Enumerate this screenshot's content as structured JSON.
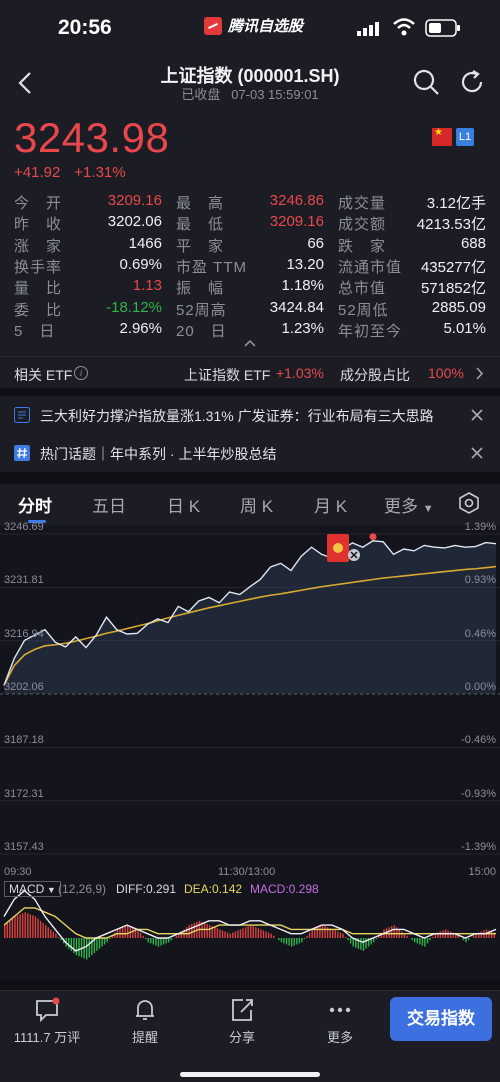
{
  "status_bar": {
    "time": "20:56",
    "app_name": "腾讯自选股"
  },
  "header": {
    "title": "上证指数 (000001.SH)",
    "market_status": "已收盘",
    "timestamp": "07-03 15:59:01"
  },
  "quote": {
    "last_price": "3243.98",
    "change": "+41.92",
    "change_pct": "+1.31%",
    "badge": "L1",
    "stats": [
      [
        {
          "label": "今　开",
          "value": "3209.16",
          "color": "red"
        },
        {
          "label": "最　高",
          "value": "3246.86",
          "color": "red"
        },
        {
          "label": "成交量",
          "value": "3.12亿手",
          "color": "white"
        }
      ],
      [
        {
          "label": "昨　收",
          "value": "3202.06",
          "color": "white"
        },
        {
          "label": "最　低",
          "value": "3209.16",
          "color": "red"
        },
        {
          "label": "成交额",
          "value": "4213.53亿",
          "color": "white"
        }
      ],
      [
        {
          "label": "涨　家",
          "value": "1466",
          "color": "white"
        },
        {
          "label": "平　家",
          "value": "66",
          "color": "white"
        },
        {
          "label": "跌　家",
          "value": "688",
          "color": "white"
        }
      ],
      [
        {
          "label": "换手率",
          "value": "0.69%",
          "color": "white"
        },
        {
          "label": "市盈 TTM",
          "value": "13.20",
          "color": "white"
        },
        {
          "label": "流通市值",
          "value": "435277亿",
          "color": "white"
        }
      ],
      [
        {
          "label": "量　比",
          "value": "1.13",
          "color": "red"
        },
        {
          "label": "振　幅",
          "value": "1.18%",
          "color": "white"
        },
        {
          "label": "总市值",
          "value": "571852亿",
          "color": "white"
        }
      ],
      [
        {
          "label": "委　比",
          "value": "-18.12%",
          "color": "green"
        },
        {
          "label": "52周高",
          "value": "3424.84",
          "color": "white"
        },
        {
          "label": "52周低",
          "value": "2885.09",
          "color": "white"
        }
      ],
      [
        {
          "label": "5　日",
          "value": "2.96%",
          "color": "white"
        },
        {
          "label": "20　日",
          "value": "1.23%",
          "color": "white"
        },
        {
          "label": "年初至今",
          "value": "5.01%",
          "color": "white"
        }
      ]
    ]
  },
  "etf": {
    "label": "相关 ETF",
    "name": "上证指数 ETF",
    "change": "+1.03%",
    "constituent_label": "成分股占比",
    "constituent_value": "100%"
  },
  "news": [
    {
      "text": "三大利好力撑沪指放量涨1.31% 广发证券：行业布局有三大思路"
    },
    {
      "text": "热门话题｜年中系列 · 上半年炒股总结"
    }
  ],
  "tabs": [
    "分时",
    "五日",
    "日 K",
    "周 K",
    "月 K",
    "更多"
  ],
  "active_tab": "分时",
  "chart_data": [
    {
      "type": "line",
      "title": "",
      "x_range": [
        "09:30",
        "15:00"
      ],
      "x_ticks": [
        "09:30",
        "11:30/13:00",
        "15:00"
      ],
      "y_ticks_left": [
        "3246.69",
        "3231.81",
        "3216.94",
        "3202.06",
        "3187.18",
        "3172.31",
        "3157.43"
      ],
      "y_ticks_right": [
        "1.39%",
        "0.93%",
        "0.46%",
        "0.00%",
        "-0.46%",
        "-0.93%",
        "-1.39%"
      ],
      "ylim": [
        3157.43,
        3246.69
      ],
      "baseline": 3202.06,
      "series": [
        {
          "values": [
            3204.5,
            3212.0,
            3217.0,
            3218.5,
            3220.0,
            3216.5,
            3215.2,
            3218.0,
            3215.0,
            3218.5,
            3223.5,
            3220.0,
            3218.8,
            3219.0,
            3221.5,
            3223.0,
            3222.0,
            3226.5,
            3225.0,
            3228.0,
            3229.0,
            3227.5,
            3230.5,
            3229.8,
            3232.0,
            3234.0,
            3237.5,
            3238.5,
            3236.5,
            3240.5,
            3243.0,
            3241.0,
            3240.0,
            3242.5,
            3244.2,
            3243.0,
            3244.8,
            3244.5,
            3241.0,
            3242.5,
            3242.0,
            3243.5,
            3243.0,
            3242.8,
            3243.5,
            3243.0,
            3243.2,
            3244.3,
            3244.0
          ]
        },
        {
          "values": [
            3204.5,
            3210.0,
            3213.0,
            3214.5,
            3215.5,
            3215.8,
            3216.2,
            3216.8,
            3217.5,
            3218.2,
            3219.0,
            3219.6,
            3220.3,
            3221.0,
            3221.7,
            3222.5,
            3223.3,
            3224.0,
            3224.7,
            3225.4,
            3226.1,
            3226.7,
            3227.3,
            3227.9,
            3228.5,
            3229.1,
            3229.6,
            3230.0,
            3230.5,
            3231.0,
            3231.5,
            3232.0,
            3232.4,
            3232.8,
            3233.2,
            3233.6,
            3234.0,
            3234.4,
            3234.7,
            3235.0,
            3235.3,
            3235.6,
            3235.9,
            3236.2,
            3236.5,
            3236.8,
            3237.0,
            3237.3,
            3237.6
          ]
        }
      ]
    },
    {
      "type": "bar",
      "title": "MACD",
      "params": "(12,26,9)",
      "diff": "0.291",
      "dea": "0.142",
      "macd": "0.298",
      "series": [
        {
          "name": "MACD",
          "values": [
            3,
            5,
            6,
            5,
            3,
            1,
            -2,
            -4,
            -5,
            -3,
            -1,
            2,
            3,
            2,
            -1,
            -2,
            -1,
            1,
            3,
            4,
            3,
            2,
            1,
            2,
            3,
            2,
            1,
            -1,
            -2,
            -1,
            2,
            3,
            2,
            1,
            -2,
            -3,
            -1,
            2,
            3,
            1,
            -1,
            -2,
            1,
            2,
            1,
            -1,
            1,
            2,
            1
          ]
        },
        {
          "name": "DIFF",
          "values": [
            5,
            9,
            11,
            9,
            5,
            2,
            -1,
            -3,
            -2,
            0,
            1,
            2,
            3,
            2,
            1,
            0,
            0,
            1,
            2,
            3,
            4,
            4,
            3,
            3,
            4,
            4,
            3,
            2,
            1,
            1,
            2,
            3,
            3,
            2,
            0,
            -1,
            0,
            1,
            2,
            2,
            1,
            0,
            1,
            1,
            1,
            0,
            1,
            1,
            2
          ]
        },
        {
          "name": "DEA",
          "values": [
            3,
            5,
            7,
            7,
            6,
            5,
            3,
            1,
            0,
            0,
            0,
            1,
            1,
            2,
            2,
            1,
            1,
            1,
            1,
            2,
            2,
            3,
            3,
            3,
            3,
            3,
            3,
            3,
            2,
            2,
            2,
            2,
            2,
            2,
            1,
            1,
            1,
            1,
            1,
            1,
            1,
            1,
            1,
            1,
            1,
            1,
            1,
            1,
            1
          ]
        }
      ]
    }
  ],
  "bottom_bar": {
    "comments": "1111.7 万评",
    "remind": "提醒",
    "share": "分享",
    "more": "更多",
    "trade": "交易指数"
  }
}
